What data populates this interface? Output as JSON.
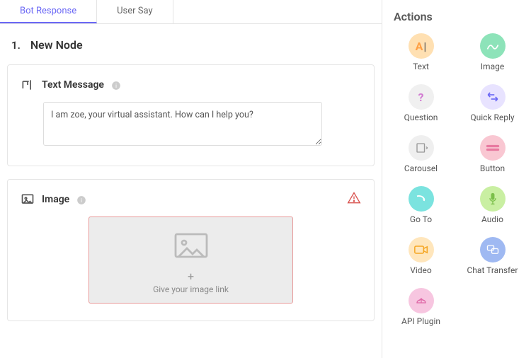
{
  "tabs": {
    "bot_response": "Bot Response",
    "user_say": "User Say"
  },
  "node": {
    "number": "1.",
    "name": "New Node"
  },
  "text_card": {
    "title": "Text Message",
    "value": "I am zoe, your virtual assistant. How can I help you?"
  },
  "image_card": {
    "title": "Image",
    "placeholder": "Give your image link"
  },
  "sidebar": {
    "title": "Actions",
    "items": [
      {
        "label": "Text"
      },
      {
        "label": "Image"
      },
      {
        "label": "Question"
      },
      {
        "label": "Quick Reply"
      },
      {
        "label": "Carousel"
      },
      {
        "label": "Button"
      },
      {
        "label": "Go To"
      },
      {
        "label": "Audio"
      },
      {
        "label": "Video"
      },
      {
        "label": "Chat Transfer"
      },
      {
        "label": "API Plugin"
      }
    ]
  }
}
